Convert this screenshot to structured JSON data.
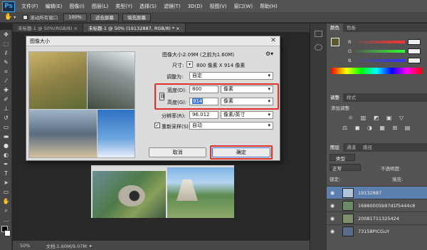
{
  "app": {
    "logo": "Ps"
  },
  "menu": [
    "文件(F)",
    "编辑(E)",
    "图像(I)",
    "图层(L)",
    "类型(Y)",
    "选择(S)",
    "滤镜(T)",
    "3D(D)",
    "视图(V)",
    "窗口(W)",
    "帮助(H)"
  ],
  "options_bar": {
    "scroll_all": "滚动所有窗口",
    "zoom_100": "100%",
    "fit_screen": "适合屏幕",
    "fill_screen": "填充屏幕"
  },
  "doc_tabs": [
    {
      "label": "未标题-1 @ 50%(RGB/8) ×",
      "active": false
    },
    {
      "label": "未标题-1 @ 50% (19132887, RGB/8) * ×",
      "active": true
    }
  ],
  "status": {
    "zoom": "50%",
    "doc": "文档:1.60M/9.07M"
  },
  "dialog": {
    "title": "图像大小",
    "image_size_label": "图像大小:",
    "image_size_value": "2.09M (之前为1.60M)",
    "dimensions_label": "尺寸:",
    "dimensions_value": "800 像素 X 914 像素",
    "fit_label": "调整为:",
    "fit_value": "自定",
    "width_label": "宽度(D):",
    "width_value": "800",
    "width_unit": "像素",
    "height_label": "高度(G):",
    "height_value": "914",
    "height_unit": "像素",
    "resolution_label": "分辨率(R):",
    "resolution_value": "96.012",
    "resolution_unit": "像素/英寸",
    "resample_label": "重新采样(S):",
    "resample_value": "自动",
    "cancel": "取消",
    "ok": "确定"
  },
  "color_panel": {
    "tabs": [
      "颜色",
      "色板"
    ],
    "channels": [
      {
        "label": "R"
      },
      {
        "label": "G"
      },
      {
        "label": "B"
      }
    ]
  },
  "adjust_panel": {
    "tabs": [
      "调整",
      "样式"
    ],
    "title": "添加调整"
  },
  "layers_panel": {
    "tabs": [
      "图层",
      "通道",
      "路径"
    ],
    "kind": "类型",
    "blend": "正常",
    "opacity_label": "不透明度:",
    "lock_label": "锁定:",
    "fill_label": "填充:",
    "layers": [
      {
        "name": "19132887",
        "selected": true
      },
      {
        "name": "16880005b97d1f5444c8",
        "selected": false
      },
      {
        "name": "20081711325424",
        "selected": false
      },
      {
        "name": "73158PICGuY",
        "selected": false
      }
    ]
  },
  "colors": {
    "accent_red": "#e0302a",
    "selection_blue": "#5b7fae"
  }
}
